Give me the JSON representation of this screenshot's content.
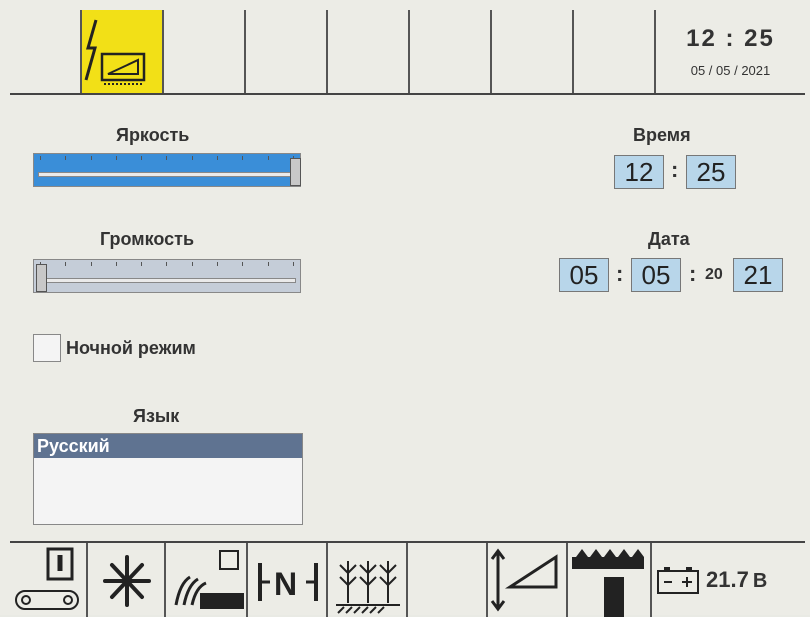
{
  "header": {
    "time": "12 : 25",
    "date": "05 / 05 / 2021",
    "active_tab_icon": "power-screen-icon",
    "colors": {
      "active_tab": "#f2e017"
    }
  },
  "settings": {
    "brightness_label": "Яркость",
    "brightness_level": 1.0,
    "volume_label": "Громкость",
    "volume_level": 0.0,
    "night_mode_label": "Ночной режим",
    "night_mode_checked": false,
    "language_label": "Язык",
    "language_selected": "Русский",
    "colors": {
      "brightness_fill": "#3a8ed8",
      "selection": "#5f7391"
    }
  },
  "time": {
    "label": "Время",
    "hours": "12",
    "sep": ":",
    "minutes": "25"
  },
  "date": {
    "label": "Дата",
    "day": "05",
    "sep1": ":",
    "month": "05",
    "sep2": ":",
    "year_prefix": "20",
    "year_suffix": "21"
  },
  "footer": {
    "battery_value": "21.7",
    "battery_unit": "B",
    "icons": [
      "conveyor-icon",
      "fan-icon",
      "plant-sensor-icon",
      "neutral-icon",
      "crop-icon",
      "empty",
      "height-adjust-icon",
      "header-icon",
      "battery-icon"
    ]
  }
}
